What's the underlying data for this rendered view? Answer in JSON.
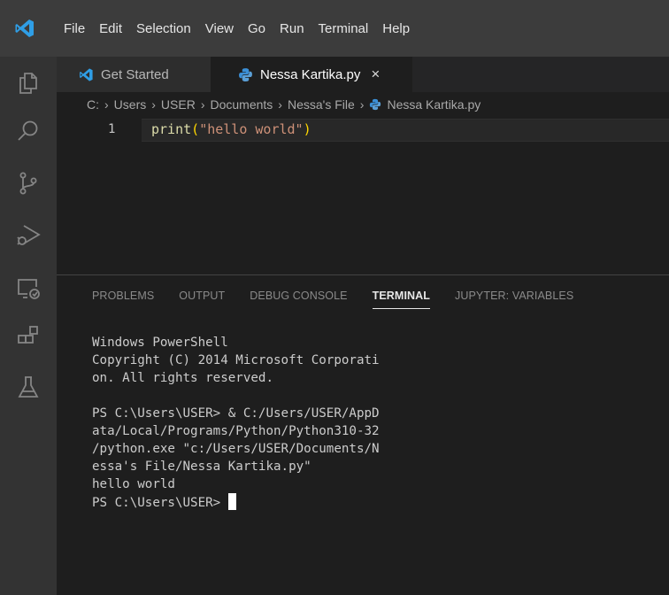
{
  "menu": {
    "items": [
      "File",
      "Edit",
      "Selection",
      "View",
      "Go",
      "Run",
      "Terminal",
      "Help"
    ]
  },
  "activity": {
    "icons": [
      "files-icon",
      "search-icon",
      "source-control-icon",
      "run-debug-icon",
      "remote-explorer-icon",
      "extensions-icon",
      "testing-icon"
    ]
  },
  "tabs": [
    {
      "label": "Get Started",
      "icon": "vscode-logo-icon"
    },
    {
      "label": "Nessa Kartika.py",
      "icon": "python-file-icon",
      "close": "×"
    }
  ],
  "breadcrumbs": {
    "parts": [
      "C:",
      "Users",
      "USER",
      "Documents",
      "Nessa's File"
    ],
    "file": "Nessa Kartika.py",
    "separator": "›"
  },
  "editor": {
    "line_number": "1",
    "code": {
      "fn": "print",
      "open": "(",
      "str": "\"hello world\"",
      "close": ")"
    }
  },
  "panel": {
    "tabs": [
      "PROBLEMS",
      "OUTPUT",
      "DEBUG CONSOLE",
      "TERMINAL",
      "JUPYTER: VARIABLES"
    ],
    "active_tab": "TERMINAL"
  },
  "terminal": {
    "lines": [
      "Windows PowerShell",
      "Copyright (C) 2014 Microsoft Corporati",
      "on. All rights reserved.",
      "",
      "PS C:\\Users\\USER> & C:/Users/USER/AppD",
      "ata/Local/Programs/Python/Python310-32",
      "/python.exe \"c:/Users/USER/Documents/N",
      "essa's File/Nessa Kartika.py\"",
      "hello world"
    ],
    "prompt": "PS C:\\Users\\USER> "
  },
  "colors": {
    "titlebar": "#3c3c3c",
    "activitybar": "#333333",
    "editor_bg": "#1e1e1e",
    "vscode_blue": "#2f9ee6",
    "python_blue": "#3b8fd6"
  }
}
